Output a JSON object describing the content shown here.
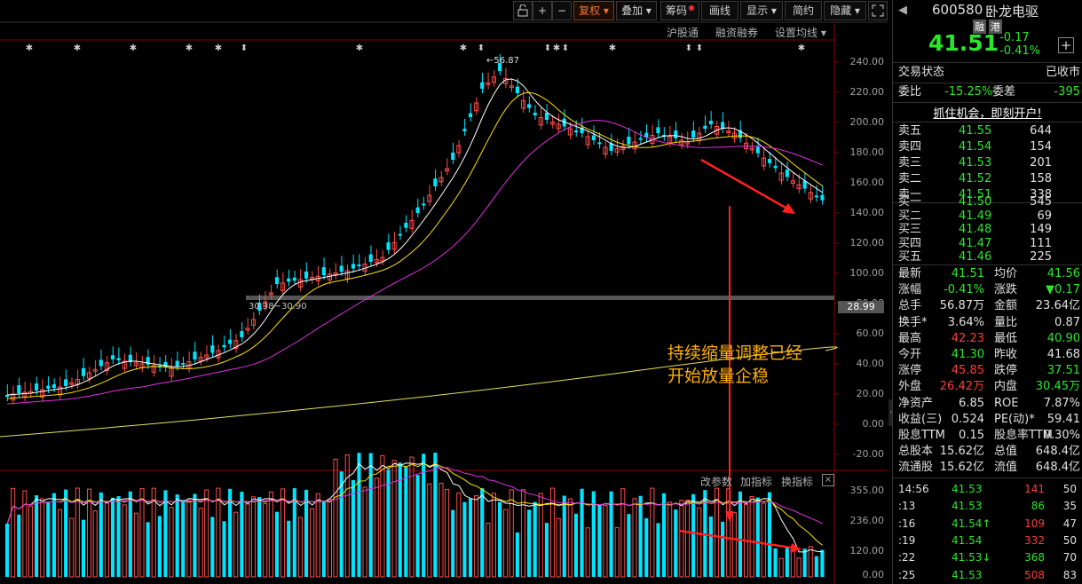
{
  "toolbar": {
    "fuquan": "复权",
    "diejia": "叠加",
    "chouma": "筹码",
    "huaxian": "画线",
    "xianshi": "显示",
    "jianyue": "简约",
    "yincang": "隐藏",
    "plus": "+",
    "minus": "−"
  },
  "subbar": {
    "hugutong": "沪股通",
    "rongzi": "融资融券",
    "set_ma": "设置均线"
  },
  "price_axis": [
    "240.00",
    "220.00",
    "200.00",
    "180.00",
    "160.00",
    "140.00",
    "120.00",
    "100.00",
    "80.00",
    "60.00",
    "40.00",
    "20.00",
    "0.00",
    "-20.00"
  ],
  "current_price_tag": "28.99",
  "high_label": "56.87",
  "range_label": "30.38~30.90",
  "annotation": {
    "line1": "持续缩量调整已经",
    "line2": "开始放量企稳"
  },
  "vol_header": {
    "gaicanshu": "改参数",
    "jiazhibiao": "加指标",
    "huanzhibiao": "换指标"
  },
  "vol_axis": [
    "355.00",
    "236.00",
    "120.00",
    "0.00"
  ],
  "stock": {
    "code": "600580",
    "name": "卧龙电驱",
    "badge1": "融",
    "badge2": "港",
    "price": "41.51",
    "change": "-0.17",
    "pct": "-0.41%"
  },
  "status": {
    "label": "交易状态",
    "value": "已收市"
  },
  "weibi": {
    "label1": "委比",
    "v1": "-15.25%",
    "label2": "委差",
    "v2": "-395"
  },
  "promo": "抓住机会，即刻开户!",
  "sells": [
    {
      "label": "卖五",
      "price": "41.55",
      "vol": "644"
    },
    {
      "label": "卖四",
      "price": "41.54",
      "vol": "154"
    },
    {
      "label": "卖三",
      "price": "41.53",
      "vol": "201"
    },
    {
      "label": "卖二",
      "price": "41.52",
      "vol": "158"
    },
    {
      "label": "卖一",
      "price": "41.51",
      "vol": "338"
    }
  ],
  "buys": [
    {
      "label": "买一",
      "price": "41.50",
      "vol": "545"
    },
    {
      "label": "买二",
      "price": "41.49",
      "vol": "69"
    },
    {
      "label": "买三",
      "price": "41.48",
      "vol": "149"
    },
    {
      "label": "买四",
      "price": "41.47",
      "vol": "111"
    },
    {
      "label": "买五",
      "price": "41.46",
      "vol": "225"
    }
  ],
  "stats": [
    {
      "l1": "最新",
      "v1": "41.51",
      "c1": "green",
      "l2": "均价",
      "v2": "41.56",
      "c2": "green"
    },
    {
      "l1": "涨幅",
      "v1": "-0.41%",
      "c1": "green",
      "l2": "涨跌",
      "v2": "▼0.17",
      "c2": "green"
    },
    {
      "l1": "总手",
      "v1": "56.87万",
      "c1": "white",
      "l2": "金额",
      "v2": "23.64亿",
      "c2": "white"
    },
    {
      "l1": "换手*",
      "v1": "3.64%",
      "c1": "white",
      "l2": "量比",
      "v2": "0.87",
      "c2": "white"
    },
    {
      "l1": "最高",
      "v1": "42.23",
      "c1": "red",
      "l2": "最低",
      "v2": "40.90",
      "c2": "green"
    },
    {
      "l1": "今开",
      "v1": "41.30",
      "c1": "green",
      "l2": "昨收",
      "v2": "41.68",
      "c2": "white"
    },
    {
      "l1": "涨停",
      "v1": "45.85",
      "c1": "red",
      "l2": "跌停",
      "v2": "37.51",
      "c2": "green"
    },
    {
      "l1": "外盘",
      "v1": "26.42万",
      "c1": "red",
      "l2": "内盘",
      "v2": "30.45万",
      "c2": "green"
    },
    {
      "l1": "净资产",
      "v1": "6.85",
      "c1": "white",
      "l2": "ROE",
      "v2": "7.87%",
      "c2": "white"
    },
    {
      "l1": "收益(三)",
      "v1": "0.524",
      "c1": "white",
      "l2": "PE(动)*",
      "v2": "59.41",
      "c2": "white"
    },
    {
      "l1": "股息TTM",
      "v1": "0.15",
      "c1": "white",
      "l2": "股息率TTM",
      "v2": "0.30%",
      "c2": "white"
    },
    {
      "l1": "总股本",
      "v1": "15.62亿",
      "c1": "white",
      "l2": "总值",
      "v2": "648.4亿",
      "c2": "white"
    },
    {
      "l1": "流通股",
      "v1": "15.62亿",
      "c1": "white",
      "l2": "流值",
      "v2": "648.4亿",
      "c2": "white"
    }
  ],
  "ticks": [
    {
      "t": "14:56",
      "p": "41.53",
      "v": "141",
      "n": "50",
      "vc": "red"
    },
    {
      "t": ":13",
      "p": "41.53",
      "v": "86",
      "n": "35",
      "vc": "green"
    },
    {
      "t": ":16",
      "p": "41.54↑",
      "v": "109",
      "n": "47",
      "vc": "red"
    },
    {
      "t": ":19",
      "p": "41.54",
      "v": "332",
      "n": "50",
      "vc": "red"
    },
    {
      "t": ":22",
      "p": "41.53↓",
      "v": "368",
      "n": "70",
      "vc": "green"
    },
    {
      "t": ":25",
      "p": "41.53",
      "v": "508",
      "n": "83",
      "vc": "red"
    }
  ],
  "colors": {
    "up": "#ff4c4c",
    "down": "#00e5ff",
    "ma5": "#ffffff",
    "ma10": "#ffe000",
    "ma20": "#e030e0",
    "ma_long": "#e8e060"
  }
}
